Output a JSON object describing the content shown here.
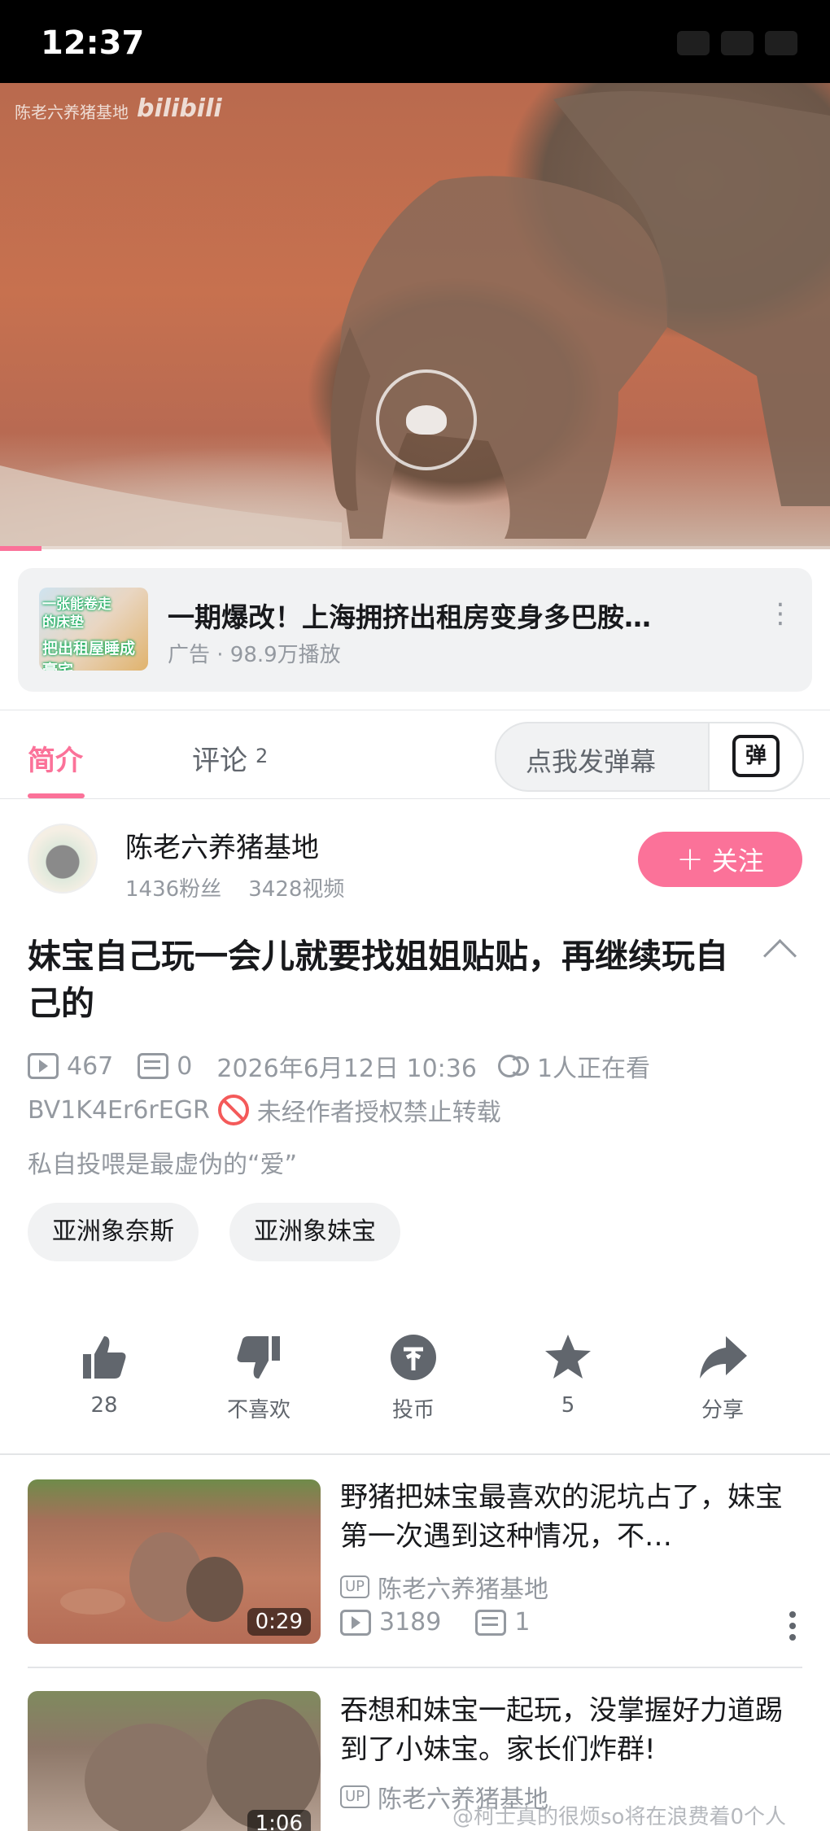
{
  "status_bar": {
    "time": "12:37"
  },
  "video": {
    "watermark": "陈老六养猪基地",
    "logo": "bilibili",
    "progress": 0.05
  },
  "ad": {
    "title": "一期爆改！上海拥挤出租房变身多巴胺…",
    "meta": "广告 · 98.9万播放",
    "thumb_text_1": "一张能卷走",
    "thumb_text_2": "的床垫",
    "thumb_text_3": "把出租屋睡成豪宅"
  },
  "tabs": {
    "intro": "简介",
    "comments": "评论",
    "comments_count": "2",
    "danmaku_placeholder": "点我发弹幕",
    "danmaku_icon": "弹"
  },
  "uploader": {
    "name": "陈老六养猪基地",
    "fans": "1436粉丝",
    "videos": "3428视频",
    "follow_label": "关注"
  },
  "video_info": {
    "title": "妹宝自己玩一会儿就要找姐姐贴贴，再继续玩自己的",
    "plays": "467",
    "danmaku": "0",
    "date": "2026年6月12日 10:36",
    "viewers": "1人正在看",
    "bvid": "BV1K4Er6rEGR",
    "copyright": "未经作者授权禁止转载",
    "description": "私自投喂是最虚伪的“爱”",
    "tags": [
      "亚洲象奈斯",
      "亚洲象妹宝"
    ]
  },
  "actions": [
    {
      "icon": "like-icon",
      "label": "28"
    },
    {
      "icon": "dislike-icon",
      "label": "不喜欢"
    },
    {
      "icon": "coin-icon",
      "label": "投币"
    },
    {
      "icon": "star-icon",
      "label": "5"
    },
    {
      "icon": "share-icon",
      "label": "分享"
    }
  ],
  "recommendations": [
    {
      "title": "野猪把妹宝最喜欢的泥坑占了，妹宝第一次遇到这种情况，不…",
      "up_badge": "UP",
      "uploader": "陈老六养猪基地",
      "plays": "3189",
      "danmaku": "1",
      "duration": "0:29"
    },
    {
      "title": "吞想和妹宝一起玩，没掌握好力道踢到了小妹宝。家长们炸群!",
      "up_badge": "UP",
      "uploader": "陈老六养猪基地",
      "duration": "1:06"
    }
  ],
  "footer_watermark": "@柯士真的很烦so将在浪费着0个人",
  "colors": {
    "accent": "#fb7299",
    "text": "#18191c",
    "secondary": "#9499a0",
    "forbid": "#f45a5a"
  }
}
